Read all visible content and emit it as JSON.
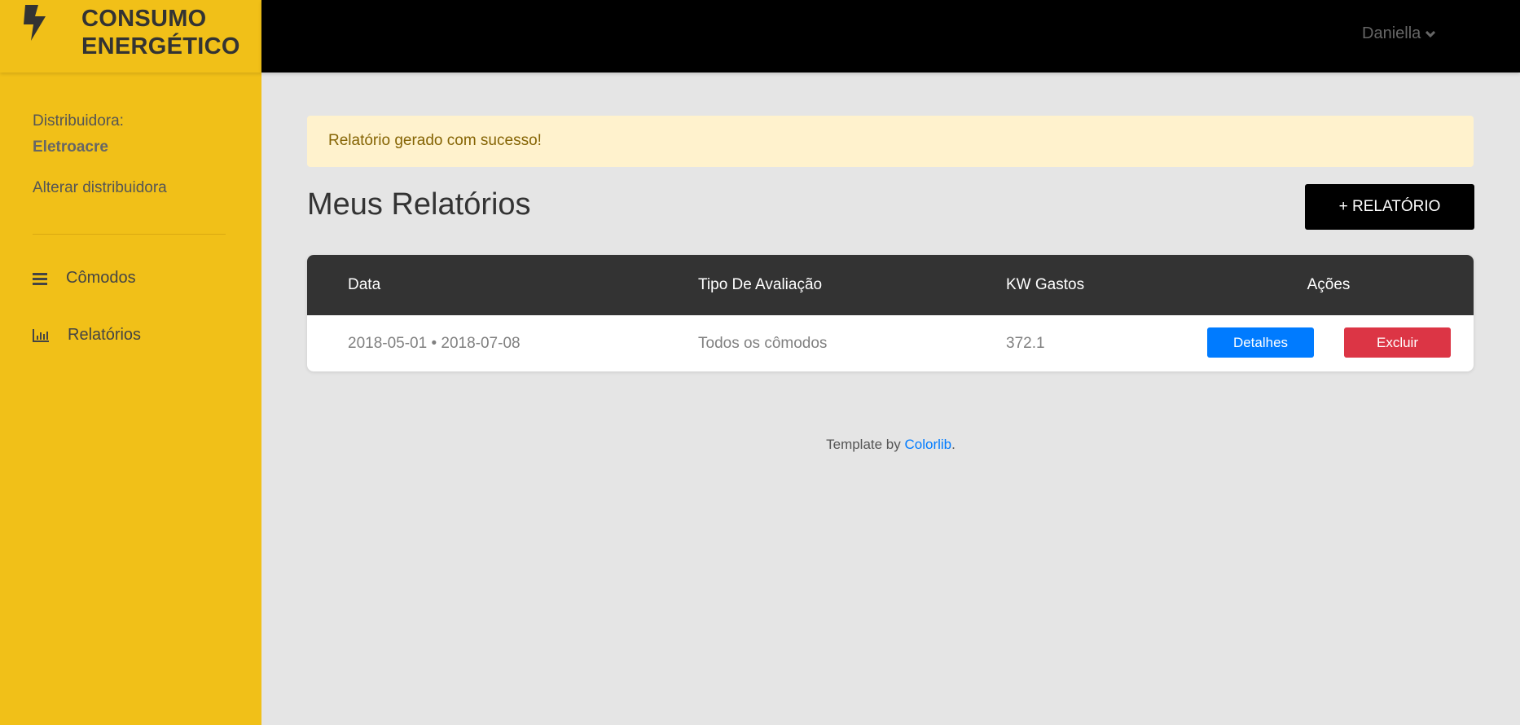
{
  "brand": {
    "title_line1": "CONSUMO",
    "title_line2": "ENERGÉTICO",
    "icon": "bolt-icon"
  },
  "sidebar": {
    "distributor_label": "Distribuidora:",
    "distributor_name": "Eletroacre",
    "change_link": "Alterar distribuidora",
    "items": [
      {
        "label": "Cômodos",
        "icon": "bars-icon"
      },
      {
        "label": "Relatórios",
        "icon": "bar-chart-icon"
      }
    ]
  },
  "topbar": {
    "user": "Daniella"
  },
  "alert": {
    "message": "Relatório gerado com sucesso!"
  },
  "main": {
    "title": "Meus Relatórios",
    "add_button": "+ RELATÓRIO",
    "table": {
      "headers": [
        "Data",
        "Tipo De Avaliação",
        "KW Gastos",
        "Ações"
      ],
      "rows": [
        {
          "date": "2018-05-01 • 2018-07-08",
          "type": "Todos os cômodos",
          "kw": "372.1",
          "details": "Detalhes",
          "delete": "Excluir"
        }
      ]
    }
  },
  "footer": {
    "prefix": "Template by ",
    "link": "Colorlib",
    "suffix": "."
  },
  "colors": {
    "sidebar": "#f1c018",
    "topbar": "#000000",
    "primary": "#007bff",
    "danger": "#dc3545",
    "alert_bg": "#fff2cd"
  }
}
